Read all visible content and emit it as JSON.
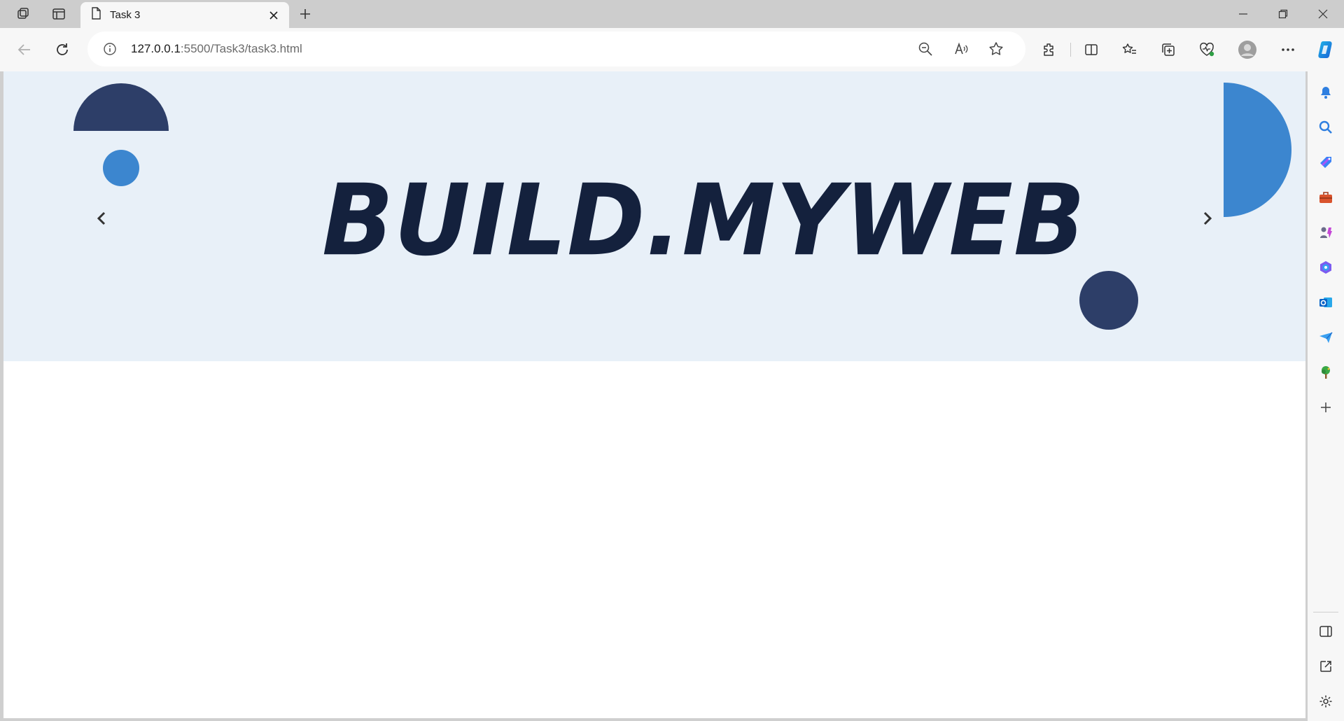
{
  "tab": {
    "title": "Task 3"
  },
  "address_bar": {
    "host": "127.0.0.1",
    "rest": ":5500/Task3/task3.html"
  },
  "page": {
    "brand": "BUILD.MYWEB",
    "colors": {
      "hero_bg": "#e8f0f8",
      "navy": "#2d3e68",
      "blue": "#3c86cf",
      "brand_text": "#14213d"
    }
  },
  "icons": {
    "workspaces": "workspaces-icon",
    "tab_actions": "tab-actions-icon",
    "page": "page-icon",
    "close": "close-icon",
    "new_tab": "plus-icon",
    "back": "back-arrow-icon",
    "refresh": "refresh-icon",
    "info": "info-icon",
    "zoom": "zoom-out-icon",
    "read_aloud": "read-aloud-icon",
    "favorite": "star-icon",
    "extensions": "puzzle-icon",
    "split": "split-screen-icon",
    "favorites": "favorites-icon",
    "collections": "collections-icon",
    "health": "browser-essentials-icon",
    "profile": "profile-avatar-icon",
    "more": "more-icon",
    "copilot": "copilot-icon"
  }
}
